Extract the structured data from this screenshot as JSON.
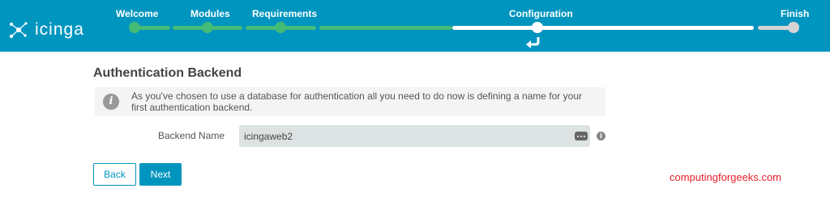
{
  "brand": {
    "name": "icinga"
  },
  "wizard": {
    "steps": [
      {
        "label": "Welcome",
        "state": "done"
      },
      {
        "label": "Modules",
        "state": "done"
      },
      {
        "label": "Requirements",
        "state": "done"
      },
      {
        "label": "Configuration",
        "state": "current"
      },
      {
        "label": "Finish",
        "state": "pending"
      }
    ]
  },
  "page": {
    "title": "Authentication Backend",
    "info": "As you've chosen to use a database for authentication all you need to do now is defining a name for your first authentication backend."
  },
  "form": {
    "backend_name_label": "Backend Name",
    "backend_name_value": "icingaweb2"
  },
  "buttons": {
    "back": "Back",
    "next": "Next"
  },
  "watermark": "computingforgeeks.com",
  "colors": {
    "header": "#0095bf",
    "progress_done": "#44bb77",
    "watermark": "#e8202a"
  },
  "icons": [
    "icinga-logo-icon",
    "return-arrow-icon",
    "info-icon",
    "field-menu-icon",
    "help-icon"
  ]
}
